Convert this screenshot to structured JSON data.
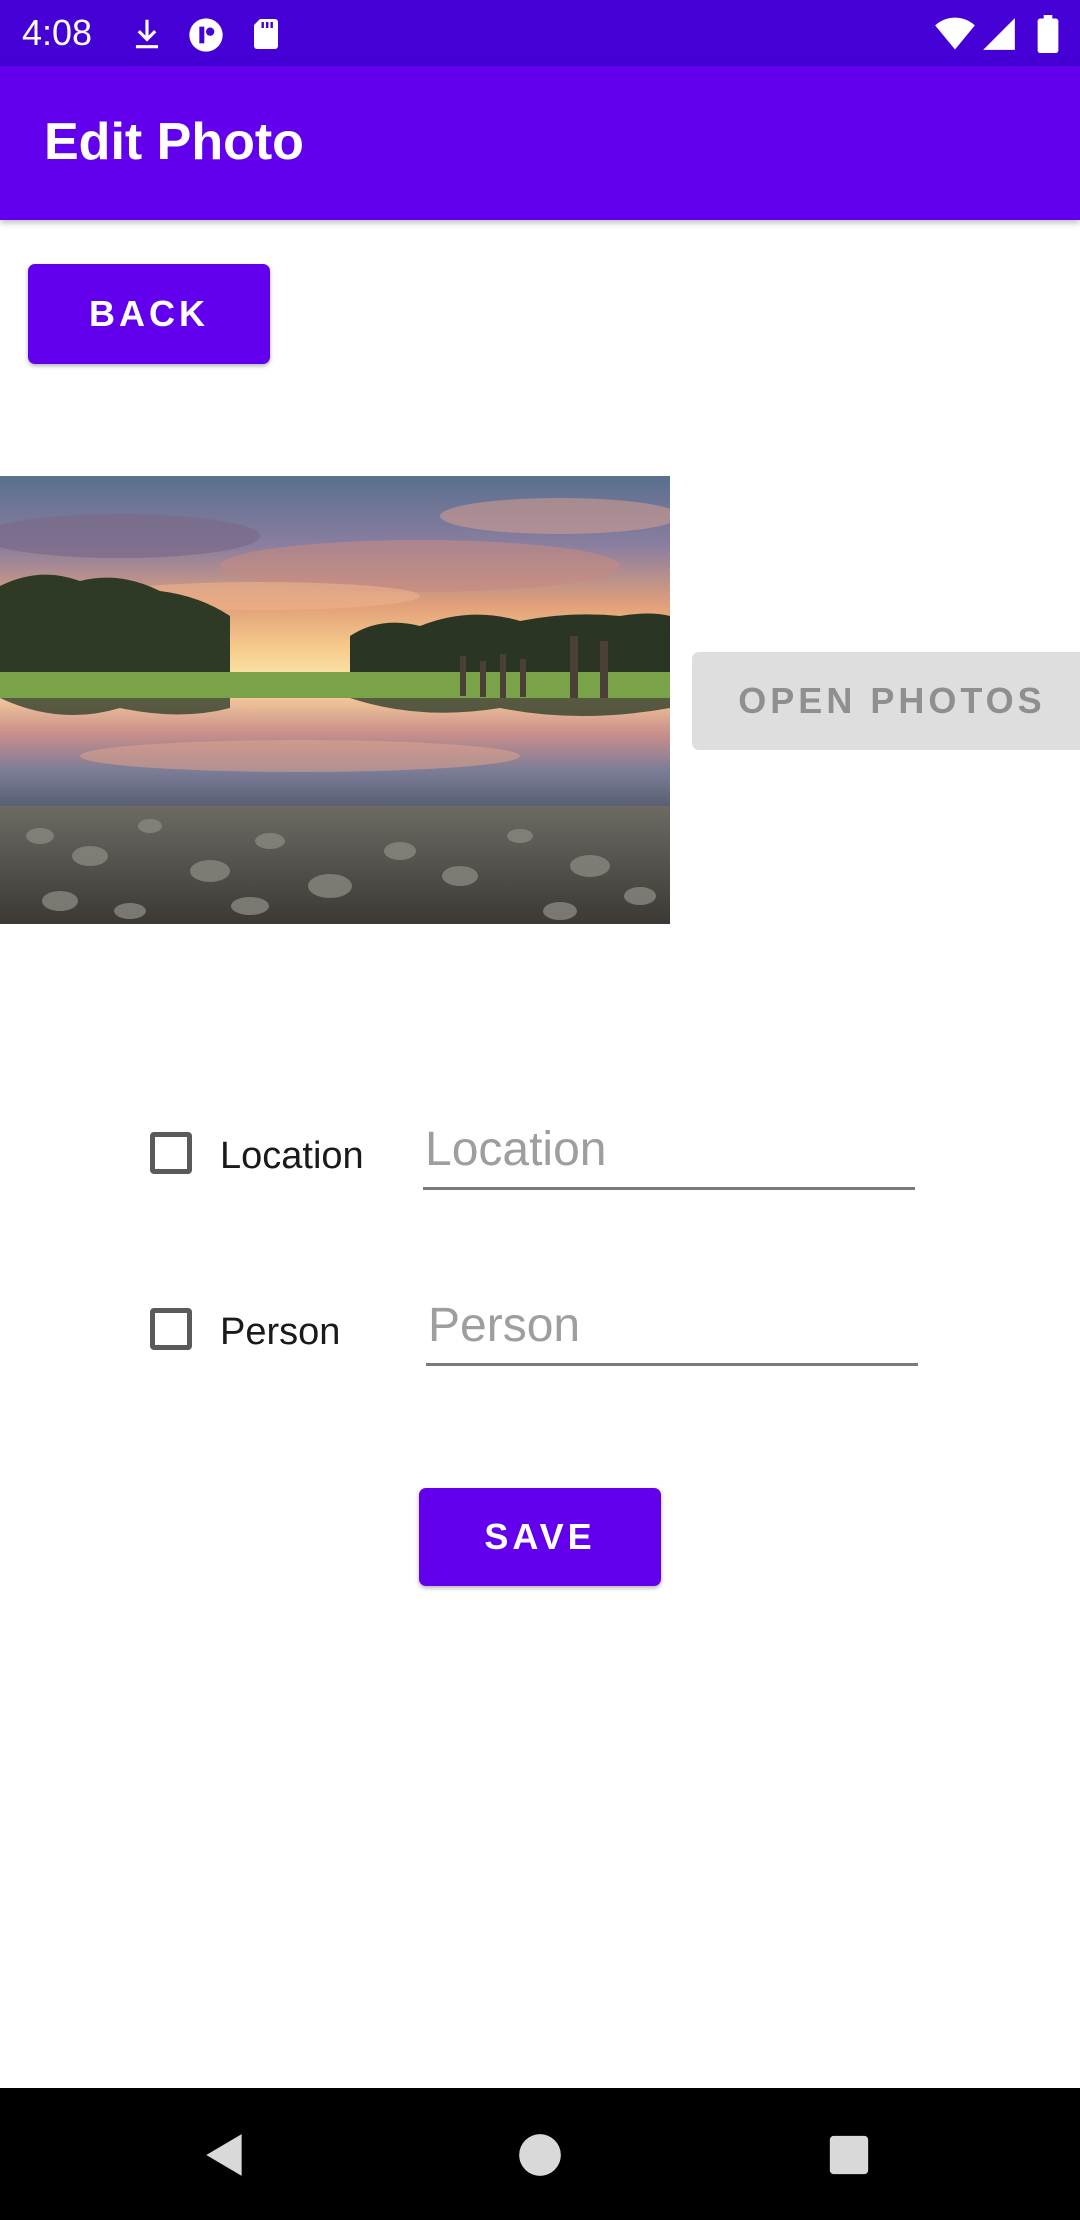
{
  "status_bar": {
    "time": "4:08",
    "left_icons": [
      "download-icon",
      "app-notification-icon",
      "sd-card-icon"
    ],
    "right_icons": [
      "wifi-icon",
      "cell-signal-icon",
      "battery-icon"
    ],
    "background_color": "#4500d6"
  },
  "app_bar": {
    "title": "Edit Photo",
    "background_color": "#6200ee"
  },
  "buttons": {
    "back_label": "BACK",
    "open_photos_label": "OPEN PHOTOS",
    "save_label": "SAVE"
  },
  "photo": {
    "subject": "sunset-reflection-over-lake-with-rocks"
  },
  "form": {
    "location": {
      "checkbox_label": "Location",
      "checked": false,
      "placeholder": "Location",
      "value": ""
    },
    "person": {
      "checkbox_label": "Person",
      "checked": false,
      "placeholder": "Person",
      "value": ""
    }
  },
  "navigation_bar": {
    "buttons": [
      "back-icon",
      "home-icon",
      "recents-icon"
    ]
  },
  "colors": {
    "accent": "#6200ee",
    "disabled_button": "#dedede",
    "disabled_text": "#8f8f8f"
  }
}
